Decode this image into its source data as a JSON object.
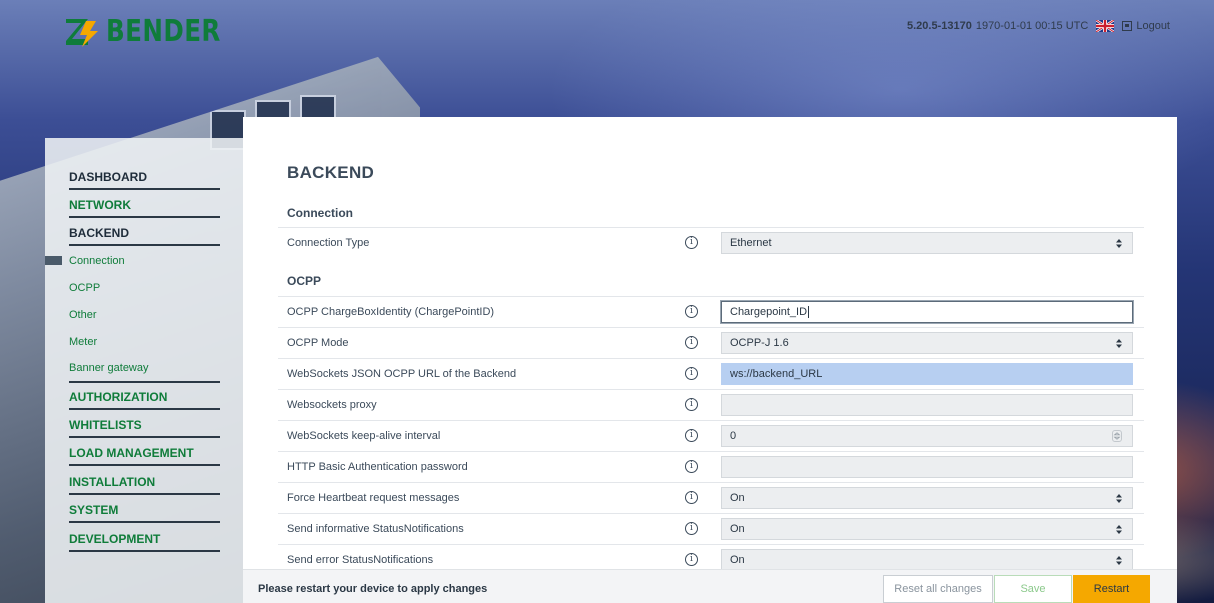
{
  "header": {
    "logo_text": "BENDER",
    "version": "5.20.5-13170",
    "datetime": "1970-01-01 00:15 UTC",
    "logout_label": "Logout"
  },
  "sidebar": {
    "items": [
      {
        "label": "DASHBOARD",
        "color": "#1e2c3a"
      },
      {
        "label": "NETWORK",
        "color": "#0f7c3a"
      },
      {
        "label": "BACKEND",
        "color": "#1e2c3a"
      },
      {
        "label": "AUTHORIZATION",
        "color": "#0f7c3a"
      },
      {
        "label": "WHITELISTS",
        "color": "#0f7c3a"
      },
      {
        "label": "LOAD MANAGEMENT",
        "color": "#0f7c3a"
      },
      {
        "label": "INSTALLATION",
        "color": "#0f7c3a"
      },
      {
        "label": "SYSTEM",
        "color": "#0f7c3a"
      },
      {
        "label": "DEVELOPMENT",
        "color": "#0f7c3a"
      }
    ],
    "sub_items": [
      "Connection",
      "OCPP",
      "Other",
      "Meter",
      "Banner gateway"
    ]
  },
  "main": {
    "title": "BACKEND",
    "sections": [
      {
        "title": "Connection",
        "rows": [
          {
            "label": "Connection Type",
            "value": "Ethernet",
            "kind": "select"
          }
        ]
      },
      {
        "title": "OCPP",
        "rows": [
          {
            "label": "OCPP ChargeBoxIdentity (ChargePointID)",
            "value": "Chargepoint_ID",
            "kind": "input-active"
          },
          {
            "label": "OCPP Mode",
            "value": "OCPP-J 1.6",
            "kind": "select"
          },
          {
            "label": "WebSockets JSON OCPP URL of the Backend",
            "value": "ws://backend_URL",
            "kind": "selected"
          },
          {
            "label": "Websockets proxy",
            "value": "",
            "kind": "input"
          },
          {
            "label": "WebSockets keep-alive interval",
            "value": "0",
            "kind": "number"
          },
          {
            "label": "HTTP Basic Authentication password",
            "value": "",
            "kind": "input"
          },
          {
            "label": "Force Heartbeat request messages",
            "value": "On",
            "kind": "select"
          },
          {
            "label": "Send informative StatusNotifications",
            "value": "On",
            "kind": "select"
          },
          {
            "label": "Send error StatusNotifications",
            "value": "On",
            "kind": "select"
          }
        ]
      }
    ]
  },
  "footer": {
    "message": "Please restart your device to apply changes",
    "reset_label": "Reset all changes",
    "save_label": "Save",
    "restart_label": "Restart"
  },
  "colors": {
    "brand_green": "#0f7c3a",
    "restart_orange": "#f5a800",
    "selection_blue": "#b7cff1"
  }
}
